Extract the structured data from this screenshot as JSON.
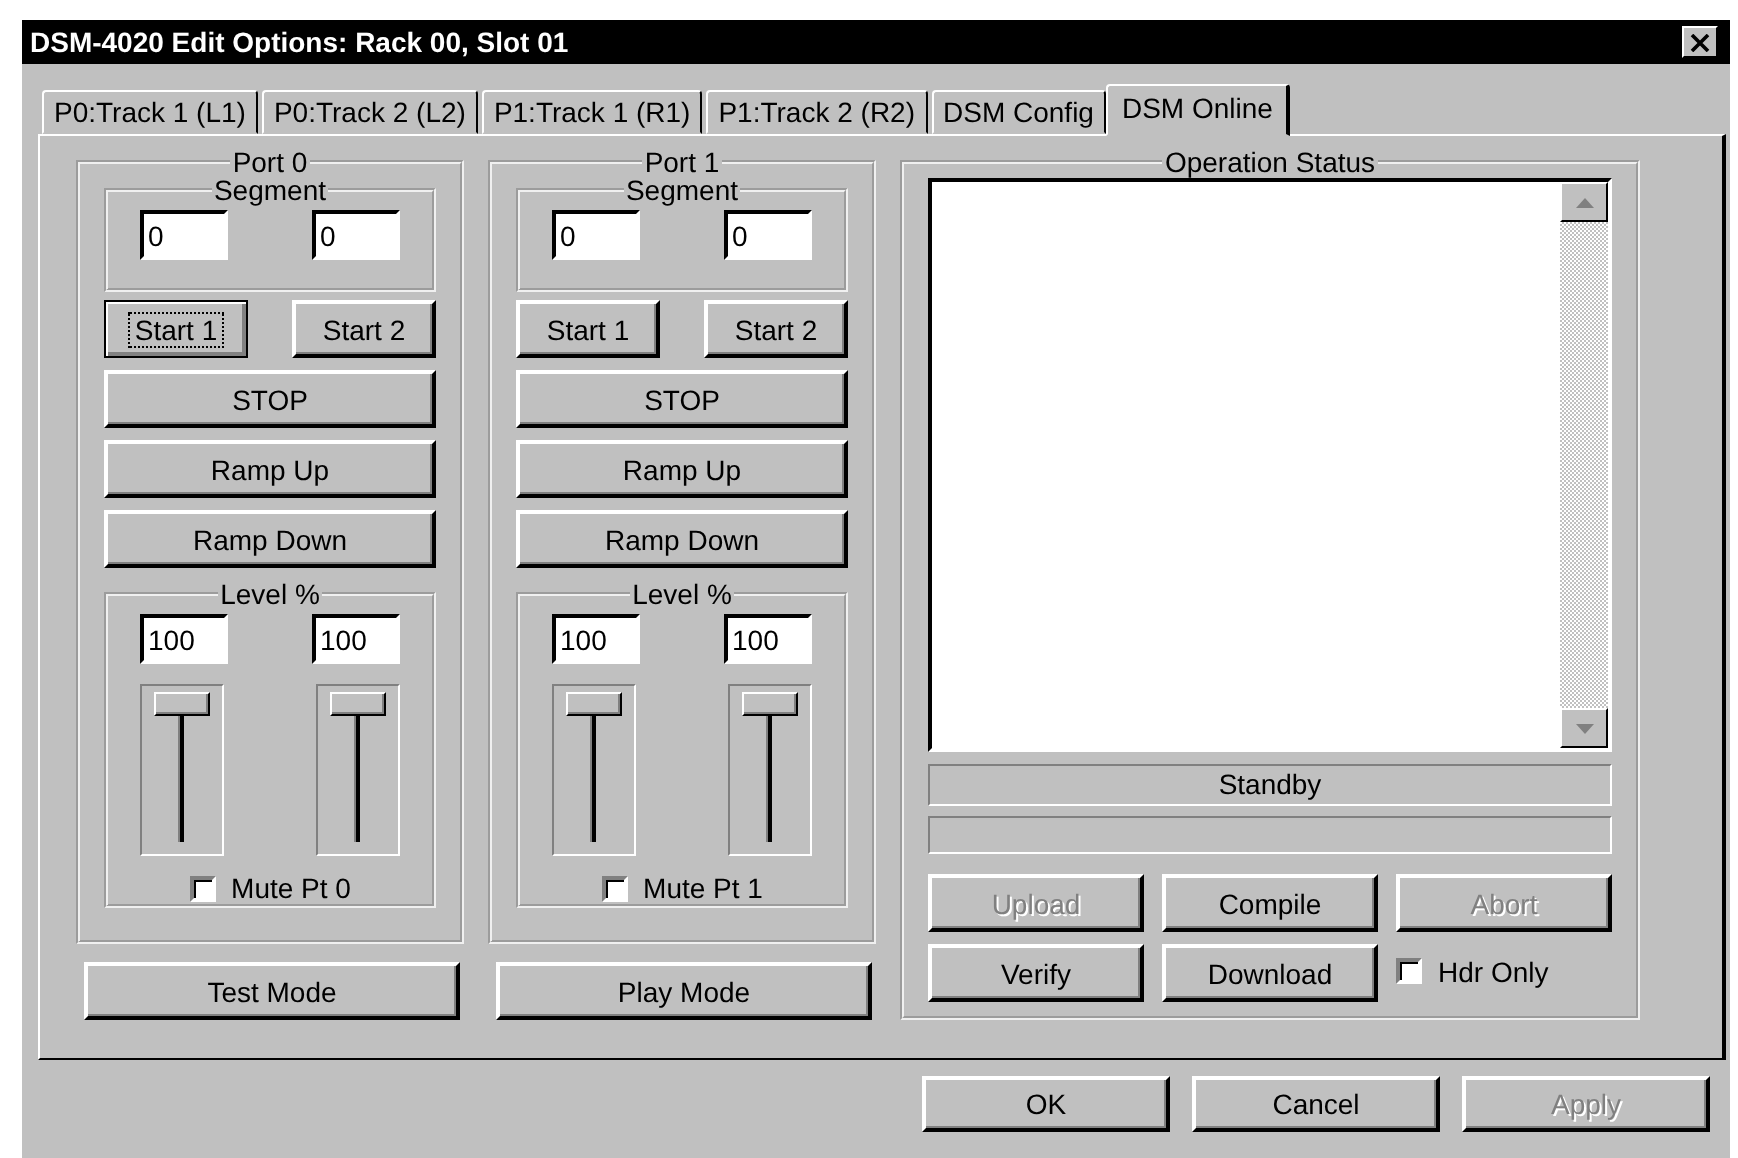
{
  "window": {
    "title": "DSM-4020 Edit Options: Rack 00, Slot 01"
  },
  "tabs": [
    {
      "label": "P0:Track 1 (L1)",
      "selected": false
    },
    {
      "label": "P0:Track 2 (L2)",
      "selected": false
    },
    {
      "label": "P1:Track 1 (R1)",
      "selected": false
    },
    {
      "label": "P1:Track 2 (R2)",
      "selected": false
    },
    {
      "label": "DSM Config",
      "selected": false
    },
    {
      "label": "DSM Online",
      "selected": true
    }
  ],
  "ports": [
    {
      "title": "Port 0",
      "segment": {
        "title": "Segment",
        "values": [
          "0",
          "0"
        ]
      },
      "start_buttons": [
        {
          "label": "Start 1",
          "focused": true
        },
        {
          "label": "Start 2",
          "focused": false
        }
      ],
      "buttons": [
        "STOP",
        "Ramp Up",
        "Ramp Down"
      ],
      "level": {
        "title": "Level %",
        "values": [
          "100",
          "100"
        ],
        "sliders": [
          {
            "level": 1
          },
          {
            "level": 1
          }
        ]
      },
      "mute": {
        "label": "Mute Pt 0",
        "checked": false
      },
      "mode_button": "Test Mode"
    },
    {
      "title": "Port 1",
      "segment": {
        "title": "Segment",
        "values": [
          "0",
          "0"
        ]
      },
      "start_buttons": [
        {
          "label": "Start 1",
          "focused": false
        },
        {
          "label": "Start 2",
          "focused": false
        }
      ],
      "buttons": [
        "STOP",
        "Ramp Up",
        "Ramp Down"
      ],
      "level": {
        "title": "Level %",
        "values": [
          "100",
          "100"
        ],
        "sliders": [
          {
            "level": 1
          },
          {
            "level": 1
          }
        ]
      },
      "mute": {
        "label": "Mute Pt 1",
        "checked": false
      },
      "mode_button": "Play Mode"
    }
  ],
  "operation_status": {
    "title": "Operation Status",
    "status": "Standby",
    "buttons": [
      {
        "label": "Upload",
        "disabled": true
      },
      {
        "label": "Compile",
        "disabled": false
      },
      {
        "label": "Abort",
        "disabled": true
      },
      {
        "label": "Verify",
        "disabled": false
      },
      {
        "label": "Download",
        "disabled": false
      }
    ],
    "hdr_only": {
      "label": "Hdr Only",
      "checked": false
    }
  },
  "dialog_buttons": [
    {
      "label": "OK",
      "disabled": false
    },
    {
      "label": "Cancel",
      "disabled": false
    },
    {
      "label": "Apply",
      "disabled": true
    }
  ]
}
